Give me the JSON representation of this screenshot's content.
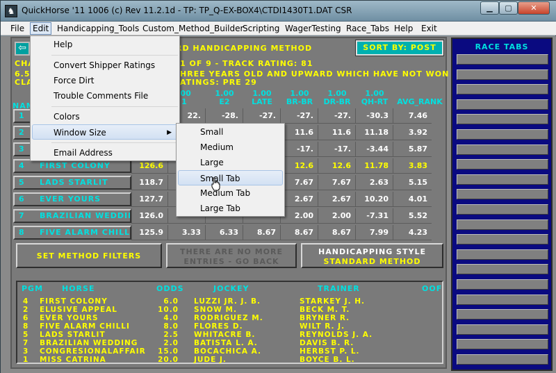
{
  "window": {
    "title": "QuickHorse '11 1006 (c) Rev 11.2.1d - TP: TP_Q-EX-BOX4\\CTDI1430T1.DAT CSR",
    "min_symbol": "▁",
    "max_symbol": "▢",
    "close_symbol": "✕"
  },
  "menubar": [
    "File",
    "Edit",
    "Handicapping_Tools",
    "Custom_Method_Builder",
    "Scripting",
    "WagerTesting",
    "Race_Tabs",
    "Help",
    "Exit"
  ],
  "edit_menu": {
    "items": [
      "Help",
      "Convert Shipper Ratings",
      "Force Dirt",
      "Trouble Comments File",
      "Colors",
      "Window Size",
      "Email Address"
    ]
  },
  "window_size_submenu": {
    "items": [
      "Small",
      "Medium",
      "Large",
      "Small Tab",
      "Medium Tab",
      "Large Tab"
    ],
    "hovered": "Small Tab"
  },
  "header": {
    "method_fragment": "RD HANDICAPPING METHOD",
    "sort_button": "SORT BY: POST",
    "line1_left": "CHA",
    "line1_right": "1 OF 9 - TRACK RATING: 81",
    "line2_left": "6.5",
    "line2_right": "HREE YEARS OLD  AND UPWARD WHICH HAVE NOT WON A",
    "line3_left": "CLA",
    "line3_right": "ATINGS: PRE 29",
    "name_col_fragment": "NAM"
  },
  "columns": [
    {
      "weight": "",
      "label": "1"
    },
    {
      "weight": "1.00",
      "label": "E2"
    },
    {
      "weight": "1.00",
      "label": "LATE"
    },
    {
      "weight": "1.00",
      "label": "BR-BR"
    },
    {
      "weight": "1.00",
      "label": "DR-BR"
    },
    {
      "weight": "1.00",
      "label": "QH-RT"
    },
    {
      "weight": "",
      "label": "AVG_RANK"
    }
  ],
  "col1_weight": ".00",
  "rows": [
    {
      "pgm": "1",
      "name": "",
      "c0": "",
      "c1": "22.",
      "c2": "-28.",
      "c3": "-27.",
      "c4": "-27.",
      "c5": "-27.",
      "c6": "-30.3",
      "rank": "7.46",
      "hl": false
    },
    {
      "pgm": "2",
      "name": "",
      "c0": "",
      "c1": "",
      "c2": "",
      "c3": "",
      "c4": "11.6",
      "c5": "11.6",
      "c6": "11.18",
      "rank": "3.92",
      "hl": false
    },
    {
      "pgm": "3",
      "name": "",
      "c0": "",
      "c1": "",
      "c2": "",
      "c3": "",
      "c4": "-17.",
      "c5": "-17.",
      "c6": "-3.44",
      "rank": "5.87",
      "hl": false
    },
    {
      "pgm": "4",
      "name": "FIRST COLONY",
      "c0": "126.6",
      "c1": "",
      "c2": "",
      "c3": "",
      "c4": "12.6",
      "c5": "12.6",
      "c6": "11.78",
      "rank": "3.83",
      "hl": true
    },
    {
      "pgm": "5",
      "name": "LADS STARLIT",
      "c0": "118.7",
      "c1": "",
      "c2": "",
      "c3": "",
      "c4": "7.67",
      "c5": "7.67",
      "c6": "2.63",
      "rank": "5.15",
      "hl": false
    },
    {
      "pgm": "6",
      "name": "EVER YOURS",
      "c0": "127.7",
      "c1": "",
      "c2": "",
      "c3": "",
      "c4": "2.67",
      "c5": "2.67",
      "c6": "10.20",
      "rank": "4.01",
      "hl": false
    },
    {
      "pgm": "7",
      "name": "BRAZILIAN WEDDIN",
      "c0": "126.0",
      "c1": "",
      "c2": "",
      "c3": "",
      "c4": "2.00",
      "c5": "2.00",
      "c6": "-7.31",
      "rank": "5.52",
      "hl": false
    },
    {
      "pgm": "8",
      "name": "FIVE ALARM CHILL",
      "c0": "125.9",
      "c1": "3.33",
      "c2": "6.33",
      "c3": "8.67",
      "c4": "8.67",
      "c5": "8.67",
      "c6": "7.99",
      "rank": "4.23",
      "hl": false
    }
  ],
  "buttons": {
    "filters": "SET METHOD FILTERS",
    "no_more_1": "THERE ARE NO MORE",
    "no_more_2": "ENTRIES - GO BACK",
    "style_1": "HANDICAPPING STYLE",
    "style_2": "STANDARD METHOD"
  },
  "entries": {
    "headers": {
      "pgm": "PGM",
      "horse": "HORSE",
      "odds": "ODDS",
      "jockey": "JOCKEY",
      "trainer": "TRAINER",
      "oof": "OOF"
    },
    "list": [
      {
        "pgm": "4",
        "horse": "FIRST COLONY",
        "odds": "6.0",
        "jockey": "LUZZI JR. J. B.",
        "trainer": "STARKEY J. H."
      },
      {
        "pgm": "2",
        "horse": "ELUSIVE APPEAL",
        "odds": "10.0",
        "jockey": "SNOW M.",
        "trainer": "BECK M. T."
      },
      {
        "pgm": "6",
        "horse": "EVER YOURS",
        "odds": "4.0",
        "jockey": "RODRIGUEZ M.",
        "trainer": "BRYNER R."
      },
      {
        "pgm": "8",
        "horse": "FIVE ALARM CHILLI",
        "odds": "8.0",
        "jockey": "FLORES D.",
        "trainer": "WILT R. J."
      },
      {
        "pgm": "5",
        "horse": "LADS STARLIT",
        "odds": "2.5",
        "jockey": "WHITACRE B.",
        "trainer": "REYNOLDS J. A."
      },
      {
        "pgm": "7",
        "horse": "BRAZILIAN WEDDING",
        "odds": "2.0",
        "jockey": "BATISTA L. A.",
        "trainer": "DAVIS B. R."
      },
      {
        "pgm": "3",
        "horse": "CONGRESIONALAFFAIR",
        "odds": "15.0",
        "jockey": "BOCACHICA A.",
        "trainer": "HERBST P. L."
      },
      {
        "pgm": "1",
        "horse": "MISS CATRINA",
        "odds": "20.0",
        "jockey": "JUDE J.",
        "trainer": "BOYCE B. L."
      }
    ]
  },
  "race_tabs": {
    "title": "RACE TABS",
    "count": 21
  },
  "colors": {
    "accent_cyan": "#00e0e0",
    "accent_yellow": "#ffff00",
    "race_tab_bg": "#0a0a80"
  }
}
